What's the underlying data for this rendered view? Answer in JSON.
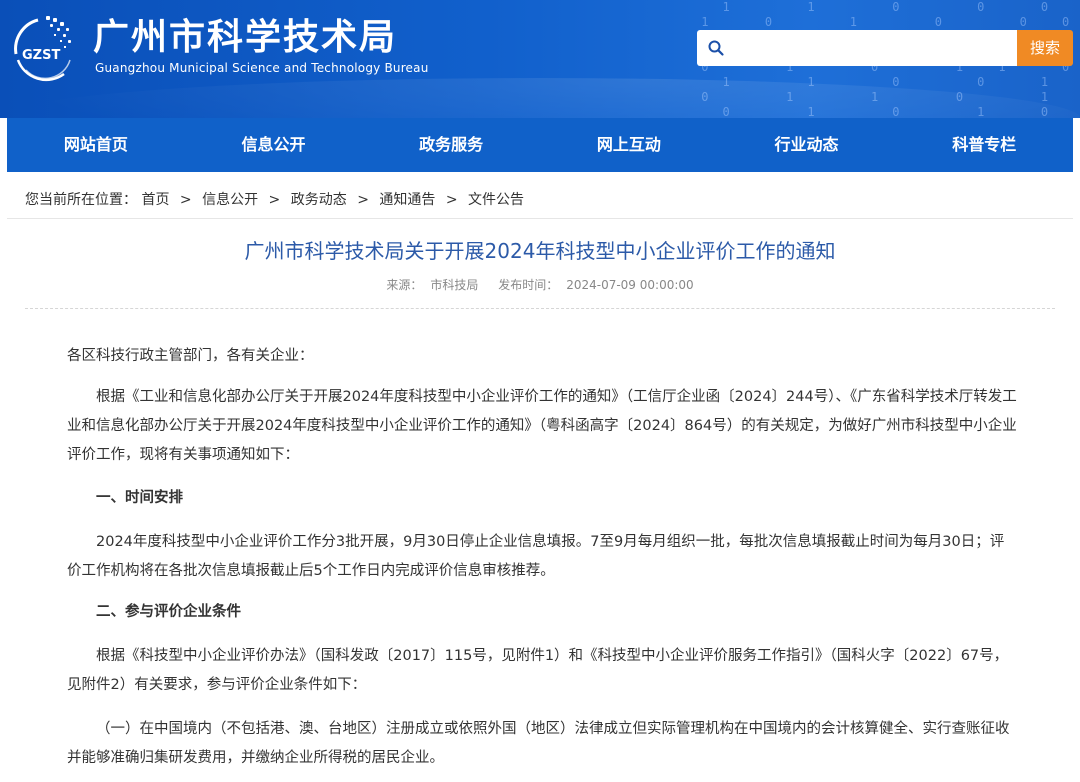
{
  "header": {
    "title": "广州市科学技术局",
    "subtitle": "Guangzhou Municipal Science and Technology Bureau",
    "logo_text": "GZST",
    "search_placeholder": "",
    "search_button": "搜索"
  },
  "nav": {
    "items": [
      "网站首页",
      "信息公开",
      "政务服务",
      "网上互动",
      "行业动态",
      "科普专栏"
    ]
  },
  "breadcrumb": {
    "prefix": "您当前所在位置：",
    "items": [
      "首页",
      "信息公开",
      "政务动态",
      "通知通告",
      "文件公告"
    ],
    "separator": ">"
  },
  "article": {
    "title": "广州市科学技术局关于开展2024年科技型中小企业评价工作的通知",
    "source_label": "来源：",
    "source": "市科技局",
    "date_label": "发布时间：",
    "date": "2024-07-09 00:00:00",
    "paragraphs": [
      "各区科技行政主管部门，各有关企业：",
      "根据《工业和信息化部办公厅关于开展2024年度科技型中小企业评价工作的通知》（工信厅企业函〔2024〕244号）、《广东省科学技术厅转发工业和信息化部办公厅关于开展2024年度科技型中小企业评价工作的通知》（粤科函高字〔2024〕864号）的有关规定，为做好广州市科技型中小企业评价工作，现将有关事项通知如下：",
      "一、时间安排",
      "2024年度科技型中小企业评价工作分3批开展，9月30日停止企业信息填报。7至9月每月组织一批，每批次信息填报截止时间为每月30日；评价工作机构将在各批次信息填报截止后5个工作日内完成评价信息审核推荐。",
      "二、参与评价企业条件",
      "根据《科技型中小企业评价办法》（国科发政〔2017〕115号，见附件1）和《科技型中小企业评价服务工作指引》（国科火字〔2022〕67号，见附件2）有关要求，参与评价企业条件如下：",
      "（一）在中国境内（不包括港、澳、台地区）注册成立或依照外国（地区）法律成立但实际管理机构在中国境内的会计核算健全、实行查账征收并能够准确归集研发费用，并缴纳企业所得税的居民企业。"
    ]
  },
  "colors": {
    "banner": "#1160cc",
    "nav": "#1061c9",
    "search_button": "#f08a24",
    "title": "#2c5aa8"
  }
}
